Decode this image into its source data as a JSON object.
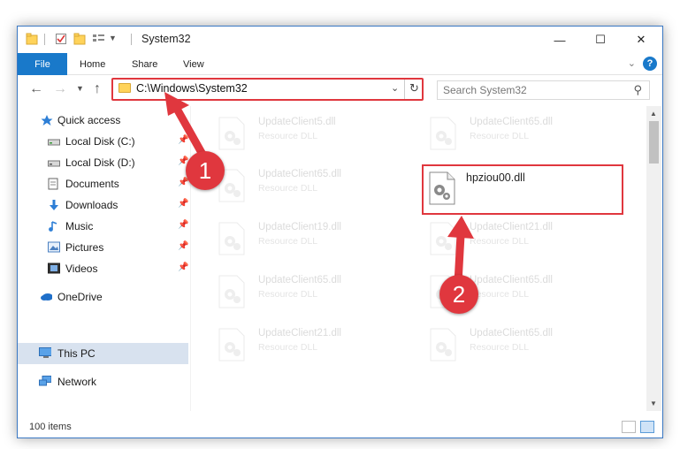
{
  "window": {
    "title": "System32",
    "controls": {
      "minimize": "—",
      "maximize": "☐",
      "close": "✕"
    }
  },
  "ribbon": {
    "file": "File",
    "tabs": [
      "Home",
      "Share",
      "View"
    ],
    "help": "?"
  },
  "navbar": {
    "address": "C:\\Windows\\System32",
    "search_placeholder": "Search System32"
  },
  "sidebar": {
    "items": [
      {
        "label": "Quick access",
        "icon": "star-icon",
        "pinned": false
      },
      {
        "label": "Local Disk (C:)",
        "icon": "drive-icon",
        "pinned": true
      },
      {
        "label": "Local Disk (D:)",
        "icon": "drive-icon",
        "pinned": true
      },
      {
        "label": "Documents",
        "icon": "documents-icon",
        "pinned": true
      },
      {
        "label": "Downloads",
        "icon": "download-icon",
        "pinned": true
      },
      {
        "label": "Music",
        "icon": "music-icon",
        "pinned": true
      },
      {
        "label": "Pictures",
        "icon": "pictures-icon",
        "pinned": true
      },
      {
        "label": "Videos",
        "icon": "videos-icon",
        "pinned": true
      },
      {
        "label": "OneDrive",
        "icon": "cloud-icon",
        "pinned": false
      },
      {
        "label": "This PC",
        "icon": "computer-icon",
        "pinned": false,
        "selected": true
      },
      {
        "label": "Network",
        "icon": "network-icon",
        "pinned": false
      }
    ]
  },
  "files": [
    {
      "name": "UpdateClient5.dll",
      "type": "Resource DLL"
    },
    {
      "name": "UpdateClient65.dll",
      "type": "Resource DLL"
    },
    {
      "name": "UpdateClient65.dll",
      "type": "Resource DLL"
    },
    {
      "name": "hpziou00.dll",
      "type": ""
    },
    {
      "name": "UpdateClient19.dll",
      "type": "Resource DLL"
    },
    {
      "name": "UpdateClient21.dll",
      "type": "Resource DLL"
    },
    {
      "name": "UpdateClient65.dll",
      "type": "Resource DLL"
    },
    {
      "name": "UpdateClient65.dll",
      "type": "Resource DLL"
    },
    {
      "name": "UpdateClient21.dll",
      "type": "Resource DLL"
    },
    {
      "name": "UpdateClient65.dll",
      "type": "Resource DLL"
    }
  ],
  "status": {
    "count": "100 items"
  },
  "callouts": [
    "1",
    "2"
  ],
  "colors": {
    "accent": "#1979ca",
    "highlight": "#e0373e"
  }
}
